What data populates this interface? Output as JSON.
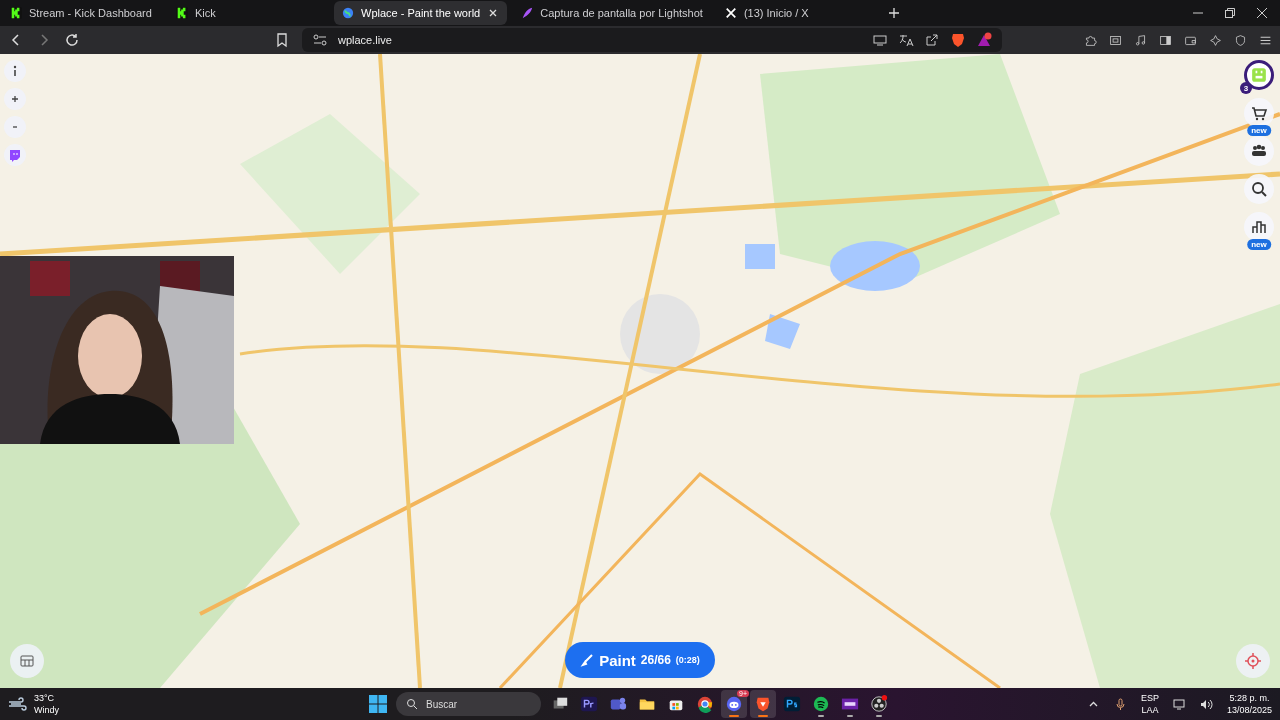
{
  "tabs": [
    {
      "title": "Stream - Kick Dashboard",
      "kind": "kick",
      "selected": false
    },
    {
      "title": "Kick",
      "kind": "kick",
      "selected": false
    },
    {
      "title": "Wplace - Paint the world",
      "kind": "globe",
      "selected": true
    },
    {
      "title": "Captura de pantalla por Lightshot",
      "kind": "feather",
      "selected": false
    },
    {
      "title": "(13) Inicio / X",
      "kind": "x",
      "selected": false
    }
  ],
  "address_bar": {
    "url": "wplace.live"
  },
  "map": {
    "right_controls": [
      {
        "kind": "profile",
        "badge": "3"
      },
      {
        "kind": "store",
        "badge": "new"
      },
      {
        "kind": "team"
      },
      {
        "kind": "search"
      },
      {
        "kind": "leaderboard",
        "badge": "new"
      }
    ],
    "paint_button": {
      "label": "Paint",
      "count": "26/66",
      "timer": "(0:28)"
    }
  },
  "taskbar": {
    "weather": {
      "temperature": "33°C",
      "condition": "Windy"
    },
    "search": {
      "placeholder": "Buscar"
    },
    "apps": [
      {
        "kind": "taskview",
        "active": false,
        "running": false
      },
      {
        "kind": "premiere",
        "active": false,
        "running": false
      },
      {
        "kind": "teams",
        "active": false,
        "running": false
      },
      {
        "kind": "files",
        "active": false,
        "running": false
      },
      {
        "kind": "store",
        "active": false,
        "running": false
      },
      {
        "kind": "chrome",
        "active": false,
        "running": false
      },
      {
        "kind": "discord",
        "active": true,
        "running": true,
        "badge": "9+"
      },
      {
        "kind": "brave",
        "active": true,
        "running": true
      },
      {
        "kind": "photoshop",
        "active": false,
        "running": false
      },
      {
        "kind": "spotify",
        "active": false,
        "running": true
      },
      {
        "kind": "next",
        "active": false,
        "running": true
      },
      {
        "kind": "obs",
        "active": false,
        "running": true
      }
    ],
    "language": {
      "code": "ESP",
      "layout": "LAA"
    },
    "time": "5:28 p. m.",
    "date": "13/08/2025"
  }
}
